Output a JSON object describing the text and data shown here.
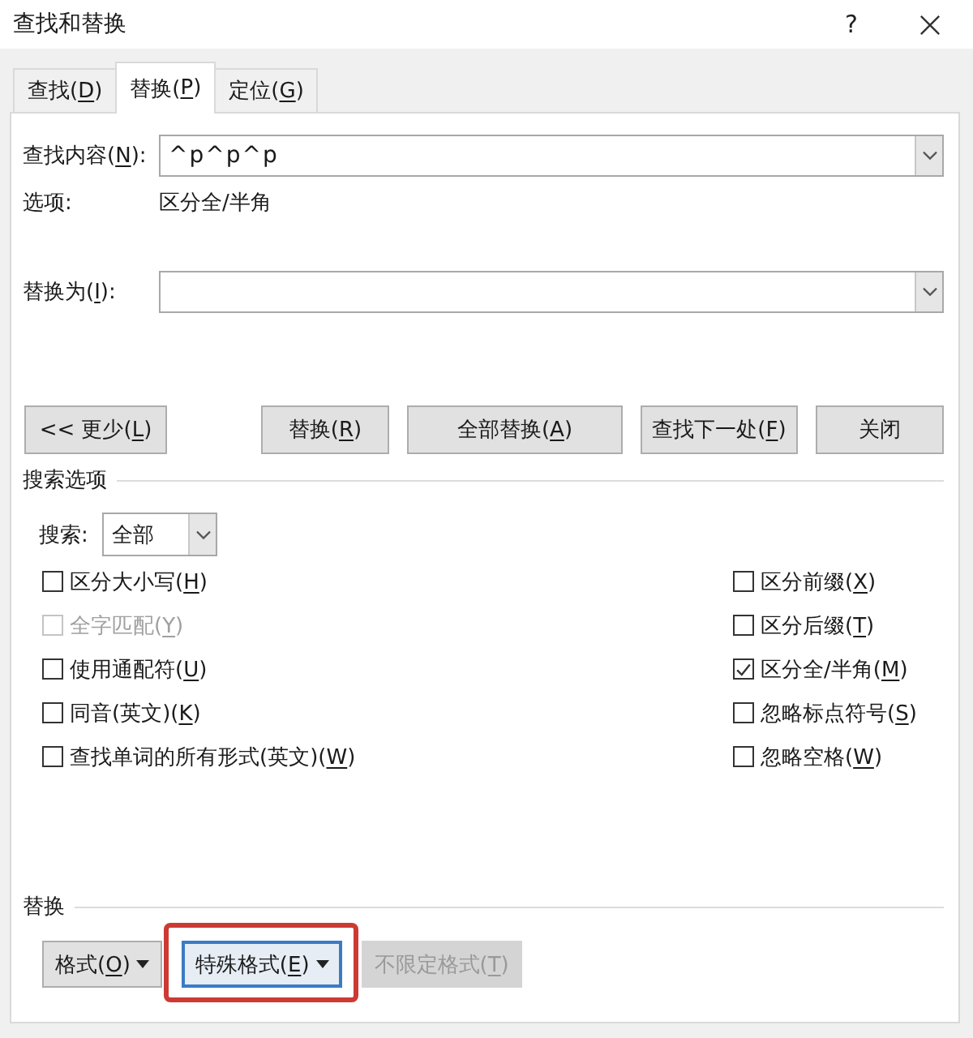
{
  "window": {
    "title": "查找和替换",
    "help": "?"
  },
  "tabs": [
    {
      "label": "查找(D)",
      "selected": false
    },
    {
      "label": "替换(P)",
      "selected": true
    },
    {
      "label": "定位(G)",
      "selected": false
    }
  ],
  "find": {
    "label": "查找内容(N):",
    "value": "^p^p^p"
  },
  "options": {
    "label": "选项:",
    "value": "区分全/半角"
  },
  "replace_with": {
    "label": "替换为(I):"
  },
  "buttons": [
    {
      "label": "<< 更少(L)"
    },
    {
      "label": "替换(R)"
    },
    {
      "label": "全部替换(A)"
    },
    {
      "label": "查找下一处(F)"
    },
    {
      "label": "关闭"
    }
  ],
  "search_options": {
    "heading": "搜索选项",
    "search_label": "搜索:",
    "search_value": "全部",
    "left": [
      {
        "label": "区分大小写(H)",
        "checked": false,
        "disabled": false
      },
      {
        "label": "全字匹配(Y)",
        "checked": false,
        "disabled": true
      },
      {
        "label": "使用通配符(U)",
        "checked": false,
        "disabled": false
      },
      {
        "label": "同音(英文)(K)",
        "checked": false,
        "disabled": false
      },
      {
        "label": "查找单词的所有形式(英文)(W)",
        "checked": false,
        "disabled": false
      }
    ],
    "right": [
      {
        "label": "区分前缀(X)",
        "checked": false,
        "disabled": false
      },
      {
        "label": "区分后缀(T)",
        "checked": false,
        "disabled": false
      },
      {
        "label": "区分全/半角(M)",
        "checked": true,
        "disabled": false
      },
      {
        "label": "忽略标点符号(S)",
        "checked": false,
        "disabled": false
      },
      {
        "label": "忽略空格(W)",
        "checked": false,
        "disabled": false
      }
    ]
  },
  "replace_section": {
    "heading": "替换",
    "buttons": [
      {
        "label": "格式(O)",
        "dropdown": true,
        "disabled": false,
        "focused": false,
        "highlighted": false
      },
      {
        "label": "特殊格式(E)",
        "dropdown": true,
        "disabled": false,
        "focused": true,
        "highlighted": true
      },
      {
        "label": "不限定格式(T)",
        "dropdown": false,
        "disabled": true,
        "focused": false,
        "highlighted": false
      }
    ]
  }
}
